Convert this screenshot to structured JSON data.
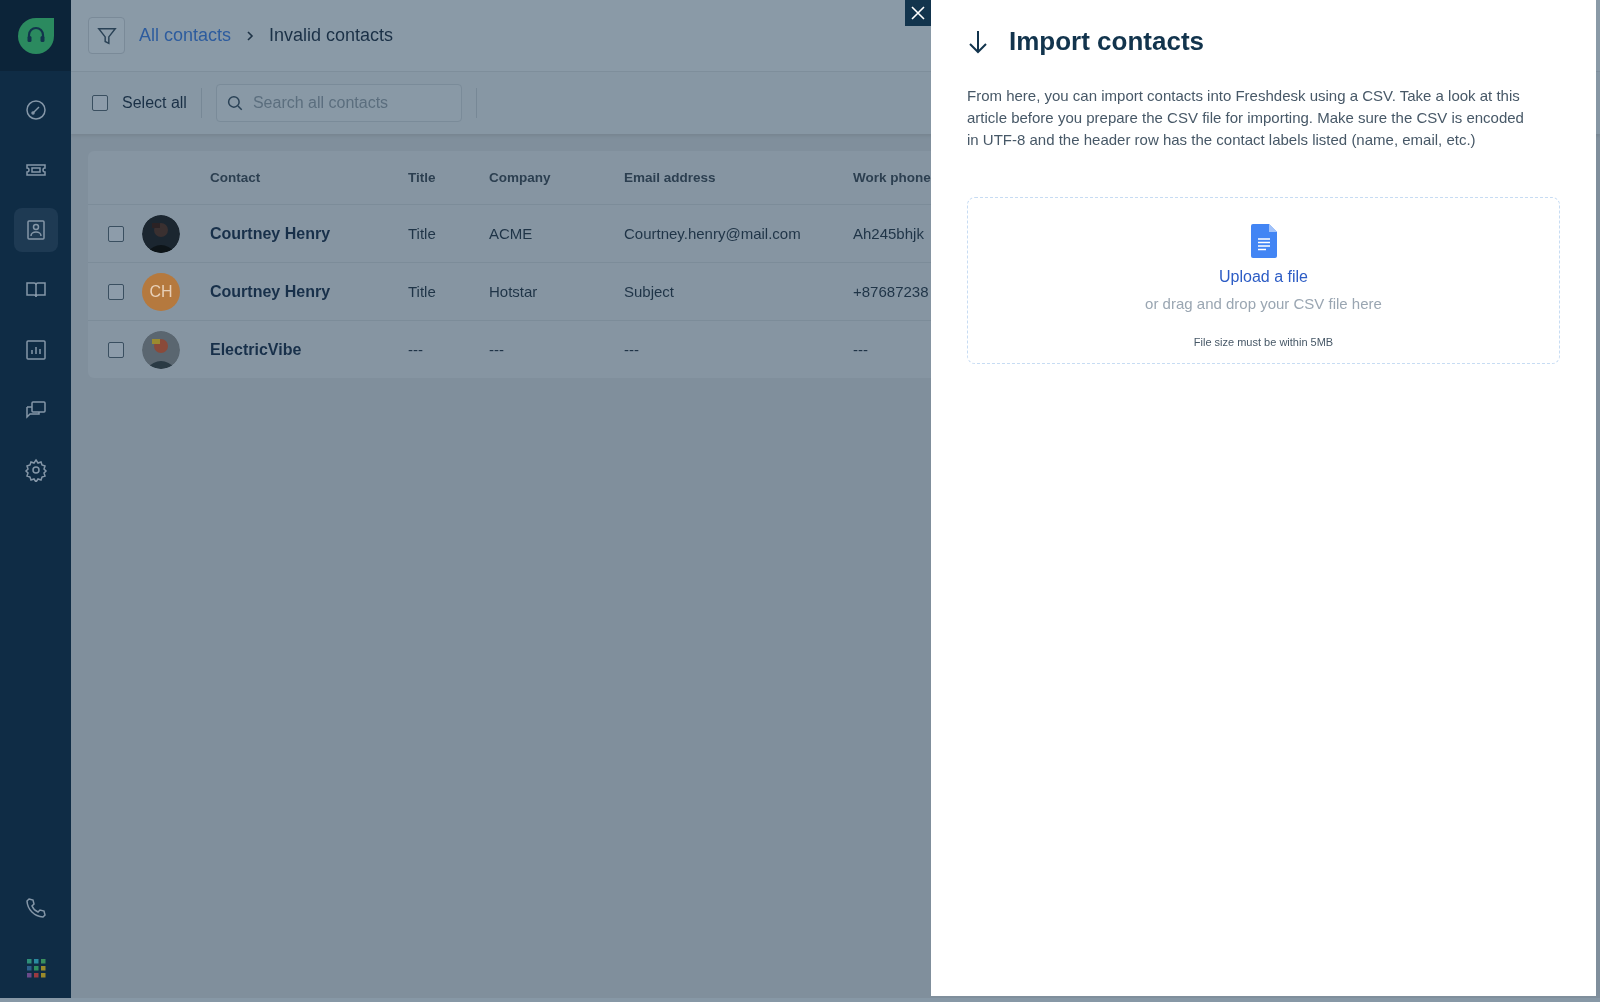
{
  "sidebar": {
    "items": [
      {
        "kind": "dashboard",
        "selected": false
      },
      {
        "kind": "tickets",
        "selected": false
      },
      {
        "kind": "contacts",
        "selected": true
      },
      {
        "kind": "book",
        "selected": false
      },
      {
        "kind": "reports",
        "selected": false
      },
      {
        "kind": "chat",
        "selected": false
      },
      {
        "kind": "settings",
        "selected": false
      }
    ],
    "bottom": [
      {
        "kind": "phone"
      },
      {
        "kind": "apps"
      }
    ]
  },
  "breadcrumb": {
    "parent": "All contacts",
    "current": "Invalid contacts"
  },
  "toolbar": {
    "select_all": {
      "label": "Select all",
      "checked": false
    },
    "search": {
      "placeholder": "Search all contacts"
    }
  },
  "table": {
    "columns": [
      "Contact",
      "Title",
      "Company",
      "Email address",
      "Work phone"
    ],
    "rows": [
      {
        "checked": false,
        "cells": [
          "Courtney Henry",
          "Title",
          "ACME",
          "Courtney.henry@mail.com",
          "Ah245bhjk"
        ]
      },
      {
        "checked": false,
        "avatar": {
          "kind": "initials",
          "text": "CH"
        },
        "cells": [
          "Courtney Henry",
          "Title",
          "Hotstar",
          "Subject",
          "+87687238"
        ]
      },
      {
        "checked": false,
        "cells": [
          "ElectricVibe",
          "---",
          "---",
          "---",
          "---"
        ]
      }
    ]
  },
  "panel": {
    "title": "Import contacts",
    "description": "From here, you can import contacts into Freshdesk using a CSV. Take a look at this article before you prepare the CSV file for importing. Make sure the CSV is encoded in UTF-8 and the header row has the contact labels listed (name, email, etc.)",
    "upload": {
      "link": "Upload a file",
      "hint": "or drag and drop your CSV file here",
      "limit": "File size must be within 5MB"
    }
  }
}
